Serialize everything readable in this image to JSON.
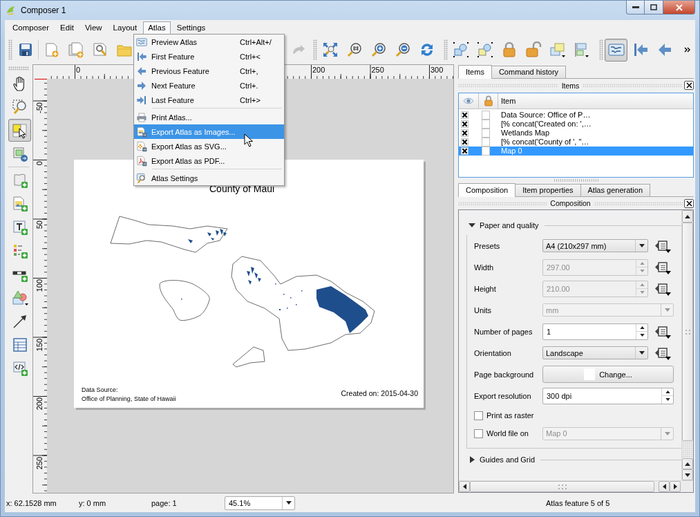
{
  "window": {
    "title": "Composer 1"
  },
  "menu_bar": [
    {
      "label": "Composer",
      "selected": false
    },
    {
      "label": "Edit",
      "selected": false
    },
    {
      "label": "View",
      "selected": false
    },
    {
      "label": "Layout",
      "selected": false
    },
    {
      "label": "Atlas",
      "selected": true
    },
    {
      "label": "Settings",
      "selected": false
    }
  ],
  "main_toolbars": [
    {
      "groups": [
        {
          "buttons": [
            {
              "kind": "save",
              "pressed": false,
              "disabled": false
            }
          ]
        },
        {
          "buttons": [
            {
              "kind": "new",
              "pressed": false,
              "disabled": false
            },
            {
              "kind": "duplicate",
              "pressed": false,
              "disabled": false
            },
            {
              "kind": "manage",
              "pressed": false,
              "disabled": false
            },
            {
              "kind": "open",
              "pressed": false,
              "disabled": false
            },
            {
              "kind": "redo",
              "pressed": false,
              "disabled": true
            }
          ]
        }
      ]
    },
    {
      "groups": [
        {
          "buttons": [
            {
              "kind": "fit",
              "pressed": false,
              "disabled": false
            },
            {
              "kind": "actual",
              "pressed": false,
              "disabled": false
            },
            {
              "kind": "zoomin",
              "pressed": false,
              "disabled": false
            },
            {
              "kind": "zoomout",
              "pressed": false,
              "disabled": false
            },
            {
              "kind": "refresh",
              "pressed": false,
              "disabled": false
            }
          ]
        }
      ]
    },
    {
      "groups": [
        {
          "buttons": [
            {
              "kind": "group",
              "pressed": false,
              "disabled": false
            },
            {
              "kind": "ungroup",
              "pressed": false,
              "disabled": false
            },
            {
              "kind": "lock",
              "pressed": false,
              "disabled": false
            },
            {
              "kind": "unlock",
              "pressed": false,
              "disabled": false
            },
            {
              "kind": "raise",
              "pressed": false,
              "disabled": false
            },
            {
              "kind": "align",
              "pressed": false,
              "disabled": false
            }
          ]
        }
      ]
    },
    {
      "groups": [
        {
          "buttons": [
            {
              "kind": "preview",
              "pressed": true,
              "disabled": false
            },
            {
              "kind": "first",
              "pressed": false,
              "disabled": false
            },
            {
              "kind": "previous",
              "pressed": false,
              "disabled": false
            }
          ]
        }
      ]
    }
  ],
  "toolbox": [
    {
      "buttons": [
        {
          "kind": "pan",
          "selected": false
        },
        {
          "kind": "zoom",
          "selected": false
        },
        {
          "kind": "select",
          "selected": true
        },
        {
          "kind": "content",
          "selected": false
        }
      ]
    },
    {
      "buttons": [
        {
          "kind": "map",
          "selected": false
        },
        {
          "kind": "image",
          "selected": false
        },
        {
          "kind": "label",
          "selected": false
        },
        {
          "kind": "legend",
          "selected": false
        },
        {
          "kind": "scalebar",
          "selected": false
        },
        {
          "kind": "shape",
          "selected": false
        },
        {
          "kind": "arrow",
          "selected": false
        },
        {
          "kind": "table",
          "selected": false
        },
        {
          "kind": "html",
          "selected": false
        }
      ]
    }
  ],
  "atlas_menu": [
    {
      "items": [
        {
          "kind": "preview",
          "label": "Preview Atlas",
          "shortcut": "Ctrl+Alt+/",
          "selected": false
        },
        {
          "kind": "first",
          "label": "First Feature",
          "shortcut": "Ctrl+<",
          "selected": false
        },
        {
          "kind": "previous",
          "label": "Previous Feature",
          "shortcut": "Ctrl+,",
          "selected": false
        },
        {
          "kind": "next",
          "label": "Next Feature",
          "shortcut": "Ctrl+.",
          "selected": false
        },
        {
          "kind": "last",
          "label": "Last Feature",
          "shortcut": "Ctrl+>",
          "selected": false
        }
      ]
    },
    {
      "items": [
        {
          "kind": "print",
          "label": "Print Atlas...",
          "selected": false
        },
        {
          "kind": "images",
          "label": "Export Atlas as Images...",
          "selected": true
        },
        {
          "kind": "svg",
          "label": "Export Atlas as SVG...",
          "selected": false
        },
        {
          "kind": "pdf",
          "label": "Export Atlas as PDF...",
          "selected": false
        }
      ]
    },
    {
      "items": [
        {
          "kind": "settings",
          "label": "Atlas Settings",
          "selected": false
        }
      ]
    }
  ],
  "canvas": {
    "horizontal_ruler": [
      "0",
      "200",
      "250",
      "300"
    ],
    "vertical_ruler": [
      "-50",
      "0",
      "50",
      "100",
      "150",
      "200",
      "250"
    ],
    "page": {
      "subtitle": "County of Maui",
      "source": "Data Source:\nOffice of Planning, State of Hawaii",
      "created": "Created on: 2015-04-30"
    }
  },
  "items_panel": {
    "tabs": [
      {
        "label": "Items",
        "selected": true
      },
      {
        "label": "Command history",
        "selected": false
      }
    ],
    "title": "Items",
    "item_column": "Item",
    "rows": [
      {
        "name": "Data Source: Office of P…",
        "visible": true,
        "locked": false,
        "selected": false
      },
      {
        "name": "[% concat('Created on: ',…",
        "visible": true,
        "locked": false,
        "selected": false
      },
      {
        "name": "Wetlands Map",
        "visible": true,
        "locked": false,
        "selected": false
      },
      {
        "name": "[% concat('County of ', \"…",
        "visible": true,
        "locked": false,
        "selected": false
      },
      {
        "name": "Map 0",
        "visible": true,
        "locked": false,
        "selected": true
      }
    ]
  },
  "composition_panel": {
    "tabs": [
      {
        "label": "Composition",
        "selected": true
      },
      {
        "label": "Item properties",
        "selected": false
      },
      {
        "label": "Atlas generation",
        "selected": false
      }
    ],
    "title": "Composition",
    "groups": [
      {
        "title": "Paper and quality",
        "expanded": true,
        "rows": [
          {
            "kind": "combo",
            "label": "Presets",
            "value": "A4 (210x297 mm)",
            "disabled": false,
            "override": true
          },
          {
            "kind": "spin",
            "label": "Width",
            "value": "297.00",
            "disabled": true,
            "override": true
          },
          {
            "kind": "spin",
            "label": "Height",
            "value": "210.00",
            "disabled": true,
            "override": true
          },
          {
            "kind": "combo",
            "label": "Units",
            "value": "mm",
            "disabled": true,
            "override": false
          },
          {
            "kind": "spin",
            "label": "Number of pages",
            "value": "1",
            "disabled": false,
            "override": true
          },
          {
            "kind": "combo",
            "label": "Orientation",
            "value": "Landscape",
            "disabled": false,
            "override": true
          },
          {
            "kind": "color",
            "label": "Page background",
            "value": "Change...",
            "color": "#ffffff",
            "override": false
          },
          {
            "kind": "spin",
            "label": "Export resolution",
            "value": "300 dpi",
            "disabled": false,
            "override": false
          },
          {
            "kind": "check",
            "label": "Print as raster",
            "checked": false
          },
          {
            "kind": "checkcombo",
            "label": "World file on",
            "checked": false,
            "value": "Map 0",
            "disabled": true
          }
        ]
      },
      {
        "title": "Guides and Grid",
        "expanded": false
      }
    ]
  },
  "status_bar": {
    "x": "x: 62.1528 mm",
    "y": "y: 0 mm",
    "page": "page: 1",
    "zoom": "45.1%",
    "atlas": "Atlas feature 5 of 5"
  }
}
